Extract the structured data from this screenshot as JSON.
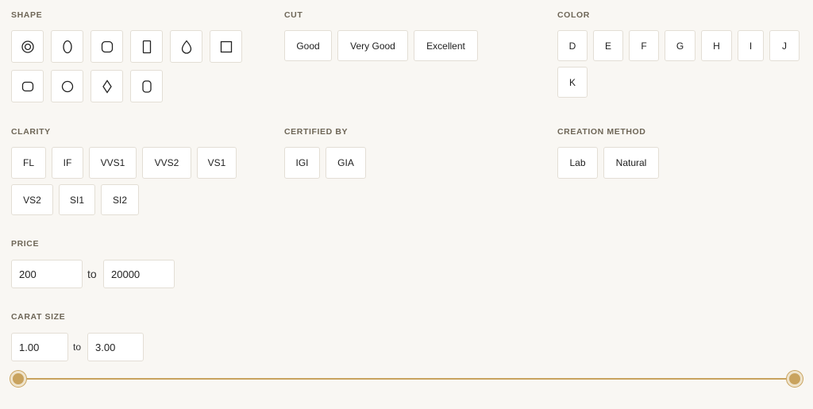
{
  "shape": {
    "label": "SHAPE",
    "items": [
      "round-icon",
      "oval-icon",
      "cushion-icon",
      "emerald-icon",
      "pear-icon",
      "asscher-icon",
      "radiant-icon",
      "round-outline-icon",
      "marquise-icon",
      "elongated-cushion-icon"
    ]
  },
  "cut": {
    "label": "CUT",
    "items": [
      "Good",
      "Very Good",
      "Excellent"
    ]
  },
  "color": {
    "label": "COLOR",
    "items": [
      "D",
      "E",
      "F",
      "G",
      "H",
      "I",
      "J",
      "K"
    ]
  },
  "clarity": {
    "label": "CLARITY",
    "items": [
      "FL",
      "IF",
      "VVS1",
      "VVS2",
      "VS1",
      "VS2",
      "SI1",
      "SI2"
    ]
  },
  "certified": {
    "label": "CERTIFIED BY",
    "items": [
      "IGI",
      "GIA"
    ]
  },
  "creation": {
    "label": "CREATION METHOD",
    "items": [
      "Lab",
      "Natural"
    ]
  },
  "price": {
    "label": "PRICE",
    "min": "200",
    "to": "to",
    "max": "20000"
  },
  "carat": {
    "label": "CARAT SIZE",
    "min": "1.00",
    "to": "to",
    "max": "3.00"
  },
  "colors": {
    "accent": "#c9a35e",
    "border": "#e3ded5",
    "background": "#f9f7f3"
  }
}
